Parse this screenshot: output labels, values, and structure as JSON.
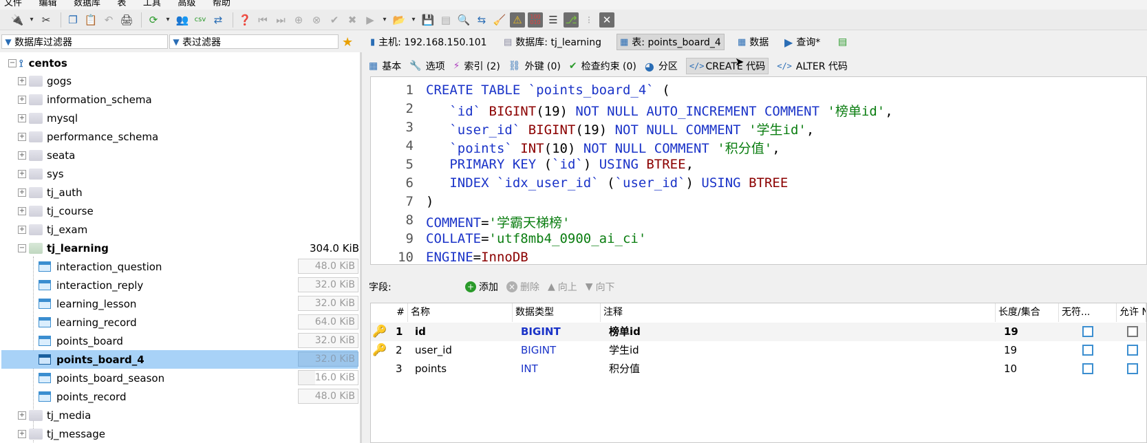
{
  "menubar": {
    "items": [
      "文件",
      "编辑",
      "数据库",
      "表",
      "工具",
      "高级",
      "帮助"
    ]
  },
  "toolbar": {
    "icons": [
      "connect-icon",
      "disconnect-icon",
      "copy-icon",
      "paste-icon",
      "undo-icon",
      "print-icon",
      "refresh-icon",
      "user-manager-icon",
      "import-csv-icon",
      "sync-icon",
      "help-icon",
      "first-icon",
      "last-icon",
      "add-row-icon",
      "delete-row-icon",
      "apply-icon",
      "cancel-icon",
      "play-icon",
      "open-folder-icon",
      "save-icon",
      "save-grey-icon",
      "search-icon",
      "replace-icon",
      "clean-icon",
      "warning-icon",
      "binary-icon",
      "wrap-icon",
      "format-icon",
      "more-icon",
      "close-icon"
    ]
  },
  "filters": {
    "db_filter": "数据库过滤器",
    "table_filter": "表过滤器"
  },
  "tabs": [
    {
      "label": "主机: 192.168.150.101",
      "icon": "host-icon"
    },
    {
      "label": "数据库: tj_learning",
      "icon": "database-icon"
    },
    {
      "label": "表: points_board_4",
      "icon": "table-icon"
    },
    {
      "label": "数据",
      "icon": "grid-icon"
    },
    {
      "label": "查询*",
      "icon": "play-icon"
    }
  ],
  "tree": {
    "root": "centos",
    "databases": [
      "gogs",
      "information_schema",
      "mysql",
      "performance_schema",
      "seata",
      "sys",
      "tj_auth",
      "tj_course",
      "tj_exam"
    ],
    "open_db": {
      "name": "tj_learning",
      "size": "304.0 KiB"
    },
    "tables": [
      {
        "name": "interaction_question",
        "size": "48.0 KiB"
      },
      {
        "name": "interaction_reply",
        "size": "32.0 KiB"
      },
      {
        "name": "learning_lesson",
        "size": "32.0 KiB"
      },
      {
        "name": "learning_record",
        "size": "64.0 KiB"
      },
      {
        "name": "points_board",
        "size": "32.0 KiB"
      },
      {
        "name": "points_board_4",
        "size": "32.0 KiB"
      },
      {
        "name": "points_board_season",
        "size": "16.0 KiB"
      },
      {
        "name": "points_record",
        "size": "48.0 KiB"
      }
    ],
    "after": [
      "tj_media",
      "tj_message"
    ]
  },
  "subtabs": [
    {
      "label": "基本",
      "icon": "grid-icon"
    },
    {
      "label": "选项",
      "icon": "wrench-icon"
    },
    {
      "label": "索引 (2)",
      "icon": "lightning-icon"
    },
    {
      "label": "外键 (0)",
      "icon": "link-icon"
    },
    {
      "label": "检查约束 (0)",
      "icon": "check-icon"
    },
    {
      "label": "分区",
      "icon": "pie-icon"
    },
    {
      "label": "CREATE 代码",
      "icon": "code-icon"
    },
    {
      "label": "ALTER 代码",
      "icon": "code-icon"
    }
  ],
  "sql": {
    "line_numbers": [
      "1",
      "2",
      "3",
      "4",
      "5",
      "6",
      "7",
      "8",
      "9",
      "10"
    ],
    "l1": [
      "CREATE TABLE ",
      "`points_board_4`",
      " ("
    ],
    "l2": [
      "`id`",
      "BIGINT",
      "(19)",
      "NOT NULL AUTO_INCREMENT COMMENT",
      "'榜单id'",
      ","
    ],
    "l3": [
      "`user_id`",
      "BIGINT",
      "(19)",
      "NOT NULL COMMENT",
      "'学生id'",
      ","
    ],
    "l4": [
      "`points`",
      "INT",
      "(10)",
      "NOT NULL COMMENT",
      "'积分值'",
      ","
    ],
    "l5": [
      "PRIMARY KEY",
      " (",
      "`id`",
      ") ",
      "USING",
      " BTREE",
      ","
    ],
    "l6": [
      "INDEX ",
      "`idx_user_id`",
      " (",
      "`user_id`",
      ") ",
      "USING",
      " BTREE"
    ],
    "l7": ")",
    "l8": [
      "COMMENT",
      "=",
      "'学霸天梯榜'"
    ],
    "l9": [
      "COLLATE",
      "=",
      "'utf8mb4_0900_ai_ci'"
    ],
    "l10": [
      "ENGINE",
      "=",
      "InnoDB"
    ]
  },
  "fields": {
    "label": "字段:",
    "add": "添加",
    "delete": "删除",
    "up": "向上",
    "down": "向下"
  },
  "grid": {
    "headers": [
      "#",
      "名称",
      "数据类型",
      "注释",
      "长度/集合",
      "无符...",
      "允许 NU"
    ],
    "rows": [
      {
        "num": "1",
        "name": "id",
        "type": "BIGINT",
        "comment": "榜单id",
        "length": "19",
        "key": "primary"
      },
      {
        "num": "2",
        "name": "user_id",
        "type": "BIGINT",
        "comment": "学生id",
        "length": "19",
        "key": "index"
      },
      {
        "num": "3",
        "name": "points",
        "type": "INT",
        "comment": "积分值",
        "length": "10",
        "key": "none"
      }
    ]
  },
  "colors": {
    "accent": "#3b8ed0",
    "keyword": "#1a33c8",
    "type": "#8b0000",
    "string": "#0a7d10",
    "selection": "#a8d2f7"
  }
}
